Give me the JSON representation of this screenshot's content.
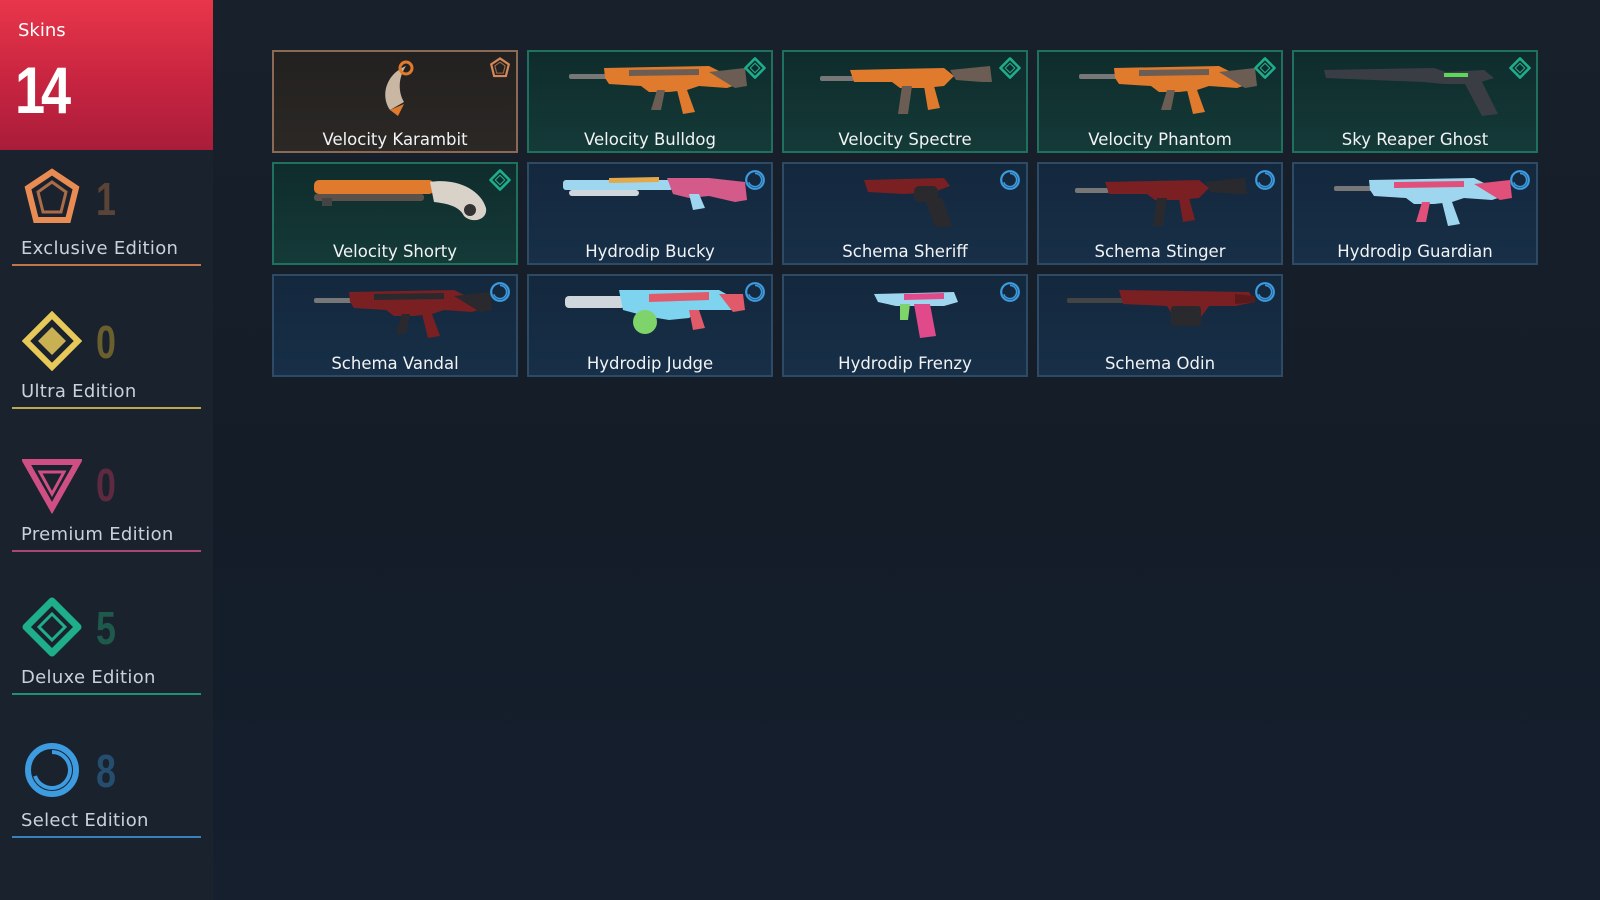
{
  "skins": {
    "label": "Skins",
    "count": "14"
  },
  "editions": [
    {
      "key": "exclusive",
      "label": "Exclusive Edition",
      "count": "1",
      "color": "#e88c54",
      "count_color": "#5a4438",
      "icon": "exclusive-pentagon-icon"
    },
    {
      "key": "ultra",
      "label": "Ultra Edition",
      "count": "0",
      "color": "#e7c95a",
      "count_color": "#6b5f2e",
      "icon": "ultra-diamond-icon"
    },
    {
      "key": "premium",
      "label": "Premium Edition",
      "count": "0",
      "color": "#cf4f85",
      "count_color": "#5e2a40",
      "icon": "premium-triangle-icon"
    },
    {
      "key": "deluxe",
      "label": "Deluxe Edition",
      "count": "5",
      "color": "#1fae8a",
      "count_color": "#1d5a4c",
      "icon": "deluxe-diamond-icon"
    },
    {
      "key": "select",
      "label": "Select Edition",
      "count": "8",
      "color": "#3d9be0",
      "count_color": "#244d6e",
      "icon": "select-circle-icon"
    }
  ],
  "skin_cards": [
    {
      "name": "Velocity Karambit",
      "tier": "exclusive",
      "weapon": "karambit",
      "colors": [
        "#c9b7a4",
        "#e07a2c"
      ]
    },
    {
      "name": "Velocity Bulldog",
      "tier": "deluxe",
      "weapon": "rifle",
      "colors": [
        "#e07a2c",
        "#6b5d53"
      ]
    },
    {
      "name": "Velocity Spectre",
      "tier": "deluxe",
      "weapon": "smg",
      "colors": [
        "#e07a2c",
        "#6b5d53"
      ]
    },
    {
      "name": "Velocity Phantom",
      "tier": "deluxe",
      "weapon": "rifle",
      "colors": [
        "#e07a2c",
        "#6b5d53"
      ]
    },
    {
      "name": "Sky Reaper Ghost",
      "tier": "deluxe",
      "weapon": "pistol-long",
      "colors": [
        "#3a3e44",
        "#5ed65a"
      ]
    },
    {
      "name": "Velocity Shorty",
      "tier": "deluxe",
      "weapon": "shotgun-short",
      "colors": [
        "#e07a2c",
        "#d9d2c8"
      ]
    },
    {
      "name": "Hydrodip Bucky",
      "tier": "select",
      "weapon": "shotgun",
      "colors": [
        "#9fd6ef",
        "#d45a8a"
      ]
    },
    {
      "name": "Schema Sheriff",
      "tier": "select",
      "weapon": "revolver",
      "colors": [
        "#7a1f22",
        "#2a2a2e"
      ]
    },
    {
      "name": "Schema Stinger",
      "tier": "select",
      "weapon": "smg",
      "colors": [
        "#7a1f22",
        "#2a2a2e"
      ]
    },
    {
      "name": "Hydrodip Guardian",
      "tier": "select",
      "weapon": "rifle",
      "colors": [
        "#9fd6ef",
        "#e0507a"
      ]
    },
    {
      "name": "Schema Vandal",
      "tier": "select",
      "weapon": "rifle",
      "colors": [
        "#7a1f22",
        "#2a2a2e"
      ]
    },
    {
      "name": "Hydrodip Judge",
      "tier": "select",
      "weapon": "shotgun-auto",
      "colors": [
        "#7ed3ef",
        "#e05a6a"
      ]
    },
    {
      "name": "Hydrodip Frenzy",
      "tier": "select",
      "weapon": "pistol",
      "colors": [
        "#9fd6ef",
        "#e04a8a"
      ]
    },
    {
      "name": "Schema Odin",
      "tier": "select",
      "weapon": "lmg",
      "colors": [
        "#7a1f22",
        "#2a2a2e"
      ]
    }
  ],
  "colors": {
    "skins_panel": "#d32c44",
    "background": "#151e2a",
    "deluxe_border": "#20705e",
    "select_border": "#2d4a66",
    "exclusive_border": "#8a6a52"
  }
}
